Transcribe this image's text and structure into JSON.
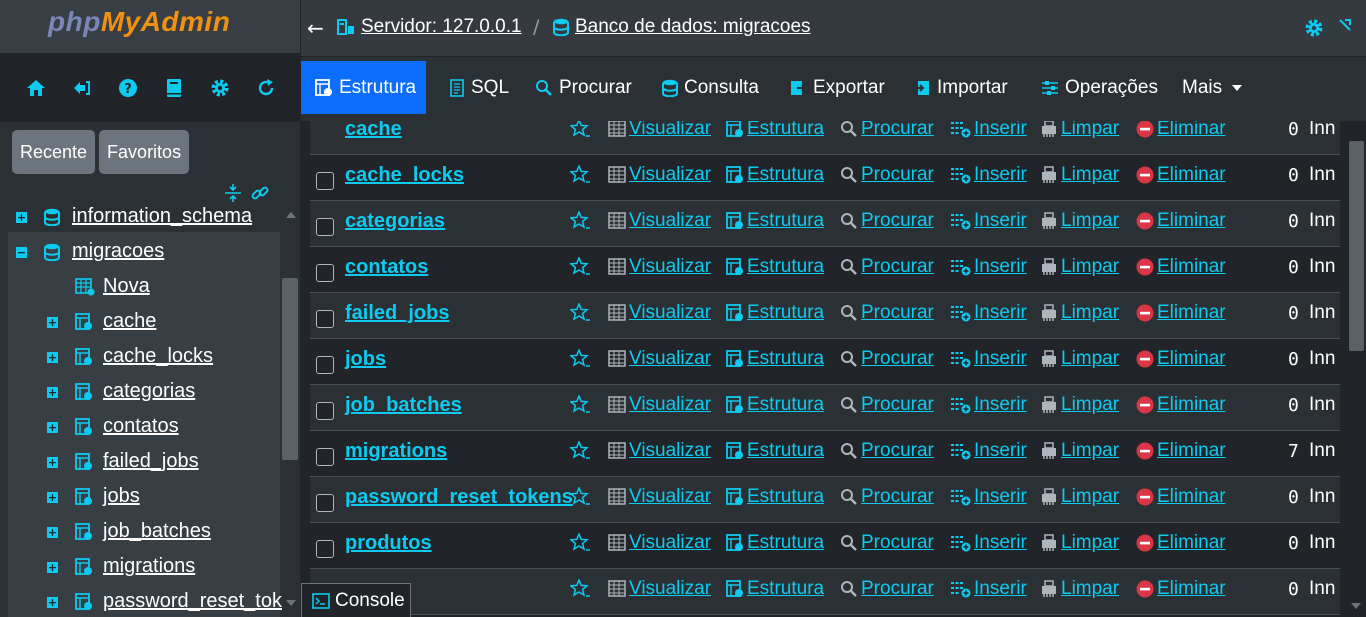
{
  "sidebar": {
    "logo_php": "php",
    "logo_myadmin": "MyAdmin",
    "nav_icons": [
      "home-icon",
      "logout-icon",
      "help-icon",
      "docs-icon",
      "settings-icon",
      "reload-icon"
    ],
    "tabs": [
      "Recente",
      "Favoritos"
    ],
    "tree": {
      "info_schema": "information_schema",
      "database": "migracoes",
      "new_item": "Nova",
      "tables": [
        "cache",
        "cache_locks",
        "categorias",
        "contatos",
        "failed_jobs",
        "jobs",
        "job_batches",
        "migrations",
        "password_reset_toke"
      ]
    }
  },
  "breadcrumb": {
    "server": "Servidor: 127.0.0.1",
    "separator": "/",
    "database": "Banco de dados: migracoes"
  },
  "topmenu": {
    "tabs": [
      "Estrutura",
      "SQL",
      "Procurar",
      "Consulta",
      "Exportar",
      "Importar",
      "Operações",
      "Mais"
    ],
    "active": "Estrutura"
  },
  "table_list": {
    "actions": [
      "Visualizar",
      "Estrutura",
      "Procurar",
      "Inserir",
      "Limpar",
      "Eliminar"
    ],
    "rows": [
      {
        "name": "cache",
        "rows": "0",
        "engine": "Inn"
      },
      {
        "name": "cache_locks",
        "rows": "0",
        "engine": "Inn"
      },
      {
        "name": "categorias",
        "rows": "0",
        "engine": "Inn"
      },
      {
        "name": "contatos",
        "rows": "0",
        "engine": "Inn"
      },
      {
        "name": "failed_jobs",
        "rows": "0",
        "engine": "Inn"
      },
      {
        "name": "jobs",
        "rows": "0",
        "engine": "Inn"
      },
      {
        "name": "job_batches",
        "rows": "0",
        "engine": "Inn"
      },
      {
        "name": "migrations",
        "rows": "7",
        "engine": "Inn"
      },
      {
        "name": "password_reset_tokens",
        "rows": "0",
        "engine": "Inn"
      },
      {
        "name": "produtos",
        "rows": "0",
        "engine": "Inn"
      },
      {
        "name": "",
        "rows": "0",
        "engine": "Inn"
      }
    ]
  },
  "console": {
    "label": "Console"
  },
  "colors": {
    "accent": "#0dcaf0",
    "active_tab": "#0d6efd",
    "delete": "#dc3545",
    "logo_orange": "#f29111",
    "logo_blue": "#7a86b8"
  }
}
